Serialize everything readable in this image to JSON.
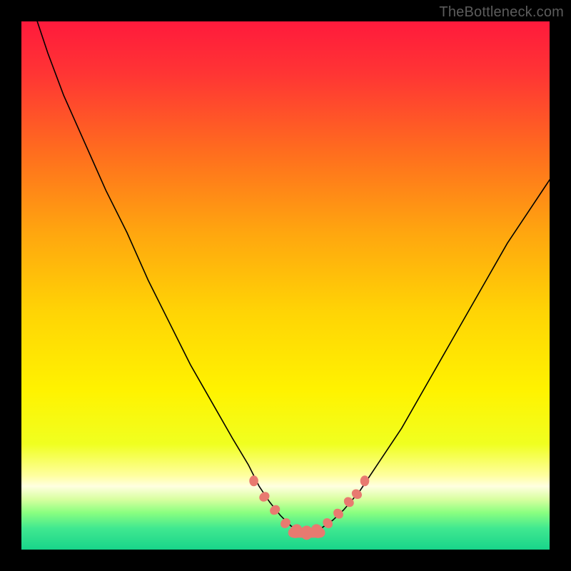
{
  "watermark": "TheBottleneck.com",
  "gradient": {
    "stops": [
      {
        "offset": 0.0,
        "color": "#ff1a3c"
      },
      {
        "offset": 0.1,
        "color": "#ff3534"
      },
      {
        "offset": 0.25,
        "color": "#ff6e1e"
      },
      {
        "offset": 0.4,
        "color": "#ffa60f"
      },
      {
        "offset": 0.55,
        "color": "#ffd405"
      },
      {
        "offset": 0.7,
        "color": "#fff300"
      },
      {
        "offset": 0.8,
        "color": "#f0ff20"
      },
      {
        "offset": 0.86,
        "color": "#ffffa0"
      },
      {
        "offset": 0.88,
        "color": "#ffffe0"
      },
      {
        "offset": 0.905,
        "color": "#d8ffa0"
      },
      {
        "offset": 0.93,
        "color": "#8aff80"
      },
      {
        "offset": 0.96,
        "color": "#40e890"
      },
      {
        "offset": 1.0,
        "color": "#18d48a"
      }
    ]
  },
  "markers": {
    "color": "#e87a70",
    "radius_small": 6,
    "radius_large": 8
  },
  "chart_data": {
    "type": "line",
    "title": "",
    "xlabel": "",
    "ylabel": "",
    "x_range": [
      0,
      100
    ],
    "y_range": [
      0,
      100
    ],
    "series": [
      {
        "name": "left-curve",
        "x": [
          3,
          5,
          8,
          12,
          16,
          20,
          24,
          28,
          32,
          36,
          40,
          43,
          45,
          47,
          49,
          51,
          53
        ],
        "y": [
          100,
          94,
          86,
          77,
          68,
          60,
          51,
          43,
          35,
          28,
          21,
          16,
          12,
          9,
          6.5,
          4.5,
          3.3
        ]
      },
      {
        "name": "right-curve",
        "x": [
          55,
          57,
          59,
          61,
          64,
          68,
          72,
          76,
          80,
          84,
          88,
          92,
          96,
          100
        ],
        "y": [
          3.3,
          4.2,
          5.6,
          7.5,
          11,
          17,
          23,
          30,
          37,
          44,
          51,
          58,
          64,
          70
        ]
      },
      {
        "name": "flat-bottom",
        "x": [
          53,
          54,
          55
        ],
        "y": [
          3.3,
          3.2,
          3.3
        ]
      }
    ],
    "markers": [
      {
        "x": 44,
        "y": 13
      },
      {
        "x": 46,
        "y": 10
      },
      {
        "x": 48,
        "y": 7.5
      },
      {
        "x": 50,
        "y": 5
      },
      {
        "x": 52,
        "y": 3.5
      },
      {
        "x": 54,
        "y": 3.2
      },
      {
        "x": 56,
        "y": 3.5
      },
      {
        "x": 58,
        "y": 5
      },
      {
        "x": 60,
        "y": 6.8
      },
      {
        "x": 62,
        "y": 9
      },
      {
        "x": 63.5,
        "y": 10.5
      },
      {
        "x": 65,
        "y": 13
      }
    ],
    "annotations": []
  }
}
